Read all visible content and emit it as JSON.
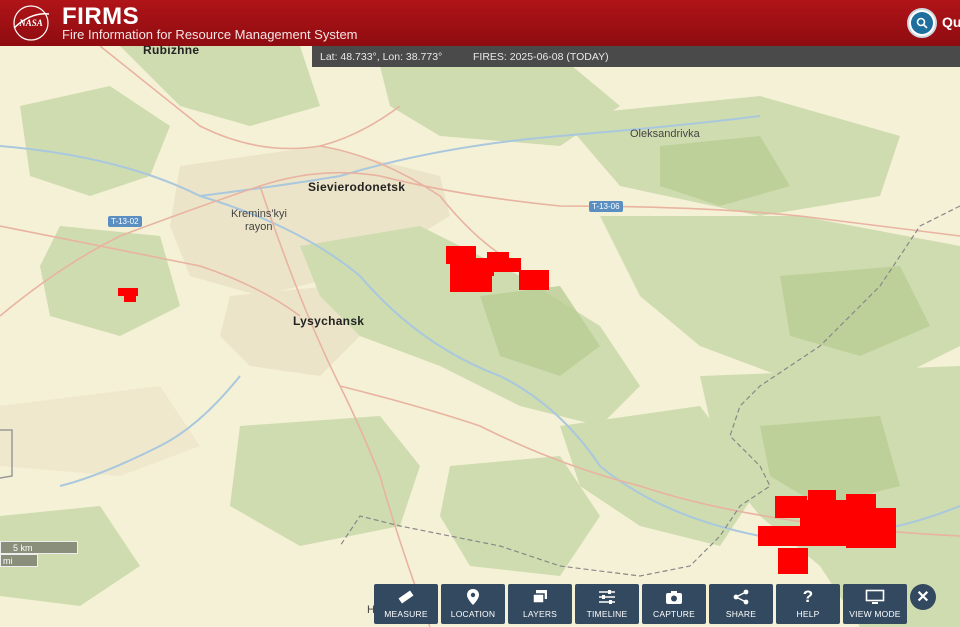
{
  "header": {
    "logo_text": "NASA",
    "title": "FIRMS",
    "subtitle": "Fire Information for Resource Management System",
    "search_label": "Qu"
  },
  "infobar": {
    "coords": "Lat: 48.733°, Lon: 38.773°",
    "fires": "FIRES: 2025-06-08 (TODAY)"
  },
  "map": {
    "labels": {
      "rubizhne": "Rubizhne",
      "oleksandrivka": "Oleksandrivka",
      "sievierodonetsk": "Sievierodonetsk",
      "kremins_1": "Kremins'kyi",
      "kremins_2": "rayon",
      "lysychansk": "Lysychansk",
      "bottom_partial": "H"
    },
    "road_shields": [
      "T-13-02",
      "T-13-06"
    ],
    "fire_color": "#ff0000"
  },
  "scale": {
    "km": "5 km",
    "mi": "mi"
  },
  "toolbar": {
    "items": [
      {
        "label": "MEASURE",
        "icon": "ruler-icon"
      },
      {
        "label": "LOCATION",
        "icon": "map-pin-icon"
      },
      {
        "label": "LAYERS",
        "icon": "layers-icon"
      },
      {
        "label": "TIMELINE",
        "icon": "sliders-icon"
      },
      {
        "label": "CAPTURE",
        "icon": "camera-icon"
      },
      {
        "label": "SHARE",
        "icon": "share-icon"
      },
      {
        "label": "HELP",
        "icon": "question-icon"
      },
      {
        "label": "VIEW MODE",
        "icon": "monitor-icon"
      }
    ],
    "close": "✕"
  }
}
